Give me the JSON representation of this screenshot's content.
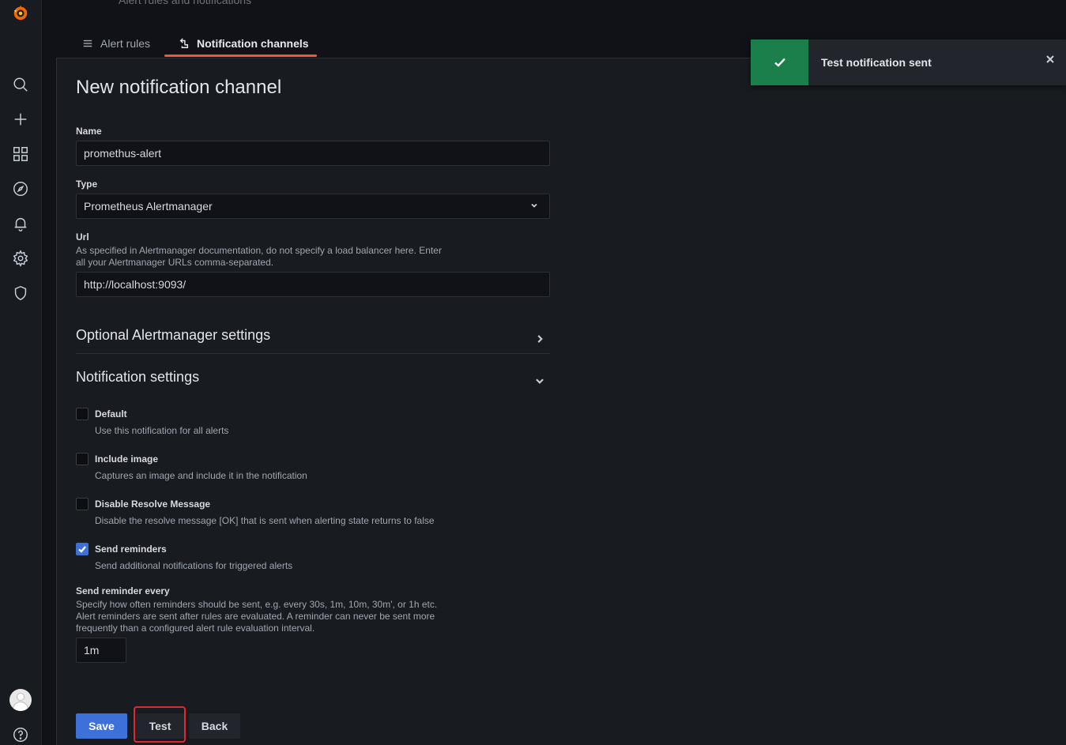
{
  "header": {
    "breadcrumb_faded": "Alert rules and notifications"
  },
  "tabs": [
    {
      "label": "Alert rules",
      "icon": "list-icon"
    },
    {
      "label": "Notification channels",
      "icon": "bell-channel-icon"
    }
  ],
  "page": {
    "title": "New notification channel"
  },
  "form": {
    "name_label": "Name",
    "name_value": "promethus-alert",
    "type_label": "Type",
    "type_value": "Prometheus Alertmanager",
    "url_label": "Url",
    "url_desc_line1": "As specified in Alertmanager documentation, do not specify a load balancer here. Enter",
    "url_desc_line2": "all your Alertmanager URLs comma-separated.",
    "url_value": "http://localhost:9093/"
  },
  "sections": {
    "optional": "Optional Alertmanager settings",
    "notification": "Notification settings"
  },
  "checkboxes": [
    {
      "label": "Default",
      "desc": "Use this notification for all alerts",
      "checked": false
    },
    {
      "label": "Include image",
      "desc": "Captures an image and include it in the notification",
      "checked": false
    },
    {
      "label": "Disable Resolve Message",
      "desc": "Disable the resolve message [OK] that is sent when alerting state returns to false",
      "checked": false
    },
    {
      "label": "Send reminders",
      "desc": "Send additional notifications for triggered alerts",
      "checked": true
    }
  ],
  "reminder": {
    "label": "Send reminder every",
    "desc_line1": "Specify how often reminders should be sent, e.g. every 30s, 1m, 10m, 30m', or 1h etc.",
    "desc_line2": "Alert reminders are sent after rules are evaluated. A reminder can never be sent more",
    "desc_line3": "frequently than a configured alert rule evaluation interval.",
    "value": "1m"
  },
  "buttons": {
    "save": "Save",
    "test": "Test",
    "back": "Back"
  },
  "toast": {
    "text": "Test notification sent",
    "status_color": "#1a7f4b"
  },
  "colors": {
    "accent": "#f05a28",
    "primary": "#3d71d9",
    "highlight": "#e2282d"
  }
}
